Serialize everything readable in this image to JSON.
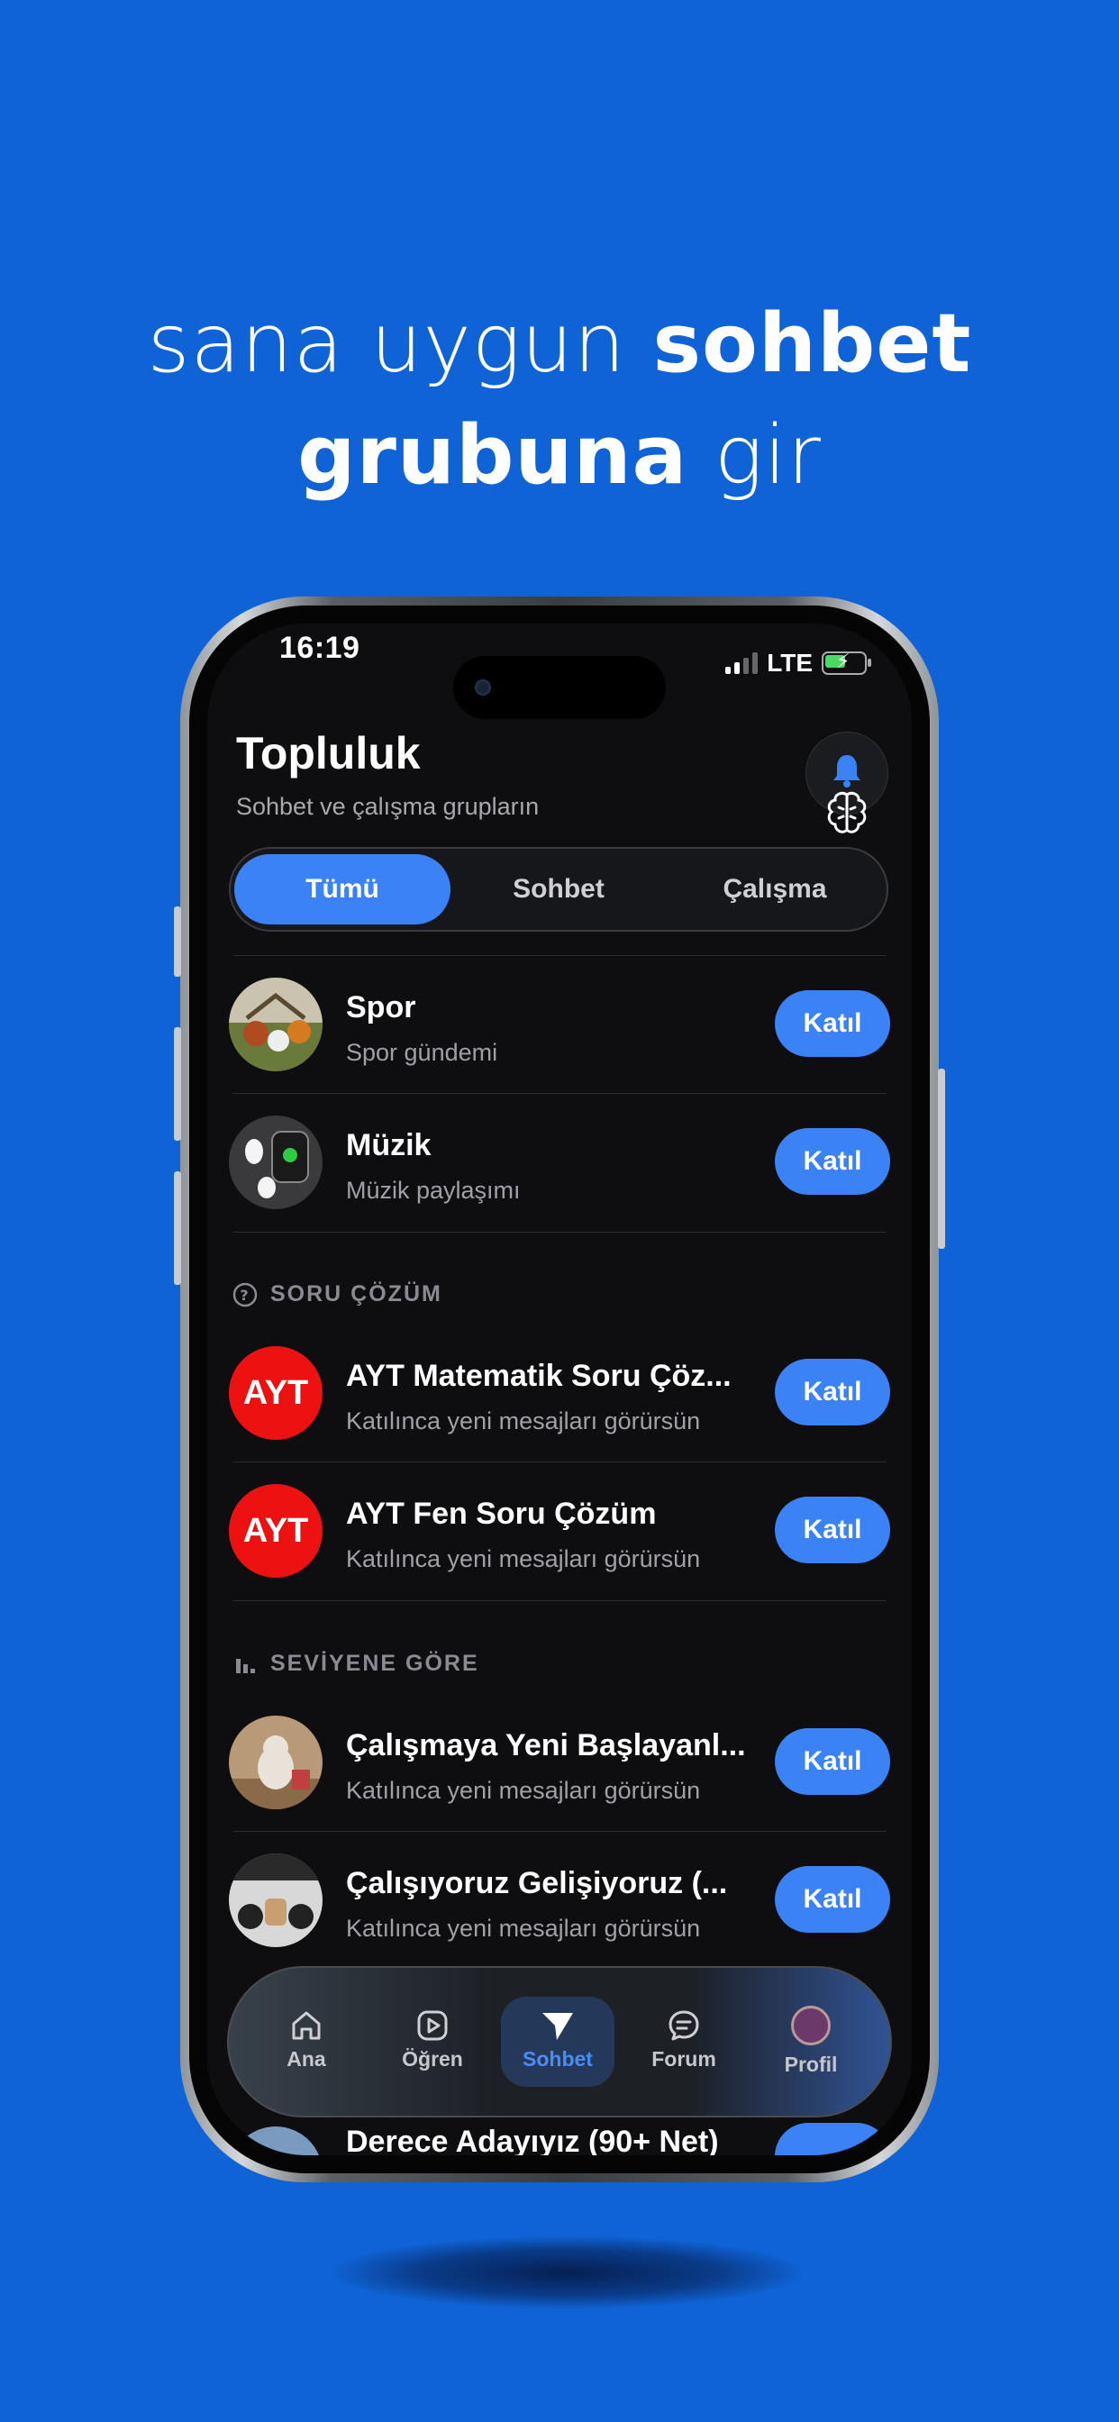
{
  "headline": {
    "line1_light": "sana uygun ",
    "line1_bold": "sohbet",
    "line2_bold": "grubuna",
    "line2_light": " gir"
  },
  "status": {
    "time": "16:19",
    "network": "LTE"
  },
  "header": {
    "title": "Topluluk",
    "subtitle": "Sohbet ve çalışma grupların"
  },
  "filter_tabs": [
    {
      "label": "Tümü",
      "active": true
    },
    {
      "label": "Sohbet",
      "active": false
    },
    {
      "label": "Çalışma",
      "active": false
    }
  ],
  "groups_top": [
    {
      "title": "Spor",
      "subtitle": "Spor gündemi",
      "join": "Katıl"
    },
    {
      "title": "Müzik",
      "subtitle": "Müzik paylaşımı",
      "join": "Katıl"
    }
  ],
  "section_soru": {
    "label": "SORU ÇÖZÜM"
  },
  "groups_soru": [
    {
      "avatar_text": "AYT",
      "title": "AYT Matematik Soru Çöz...",
      "subtitle": "Katılınca yeni mesajları görürsün",
      "join": "Katıl"
    },
    {
      "avatar_text": "AYT",
      "title": "AYT Fen Soru Çözüm",
      "subtitle": "Katılınca yeni mesajları görürsün",
      "join": "Katıl"
    }
  ],
  "section_seviye": {
    "label": "SEVİYENE GÖRE"
  },
  "groups_seviye": [
    {
      "title": "Çalışmaya Yeni Başlayanl...",
      "subtitle": "Katılınca yeni mesajları görürsün",
      "join": "Katıl"
    },
    {
      "title": "Çalışıyoruz Gelişiyoruz (...",
      "subtitle": "Katılınca yeni mesajları görürsün",
      "join": "Katıl"
    }
  ],
  "peek_row": {
    "title": "Derece Adayıyız (90+ Net)"
  },
  "tabbar": {
    "items": [
      {
        "label": "Ana",
        "icon": "home-icon"
      },
      {
        "label": "Öğren",
        "icon": "play-icon"
      },
      {
        "label": "Sohbet",
        "icon": "send-icon",
        "active": true
      },
      {
        "label": "Forum",
        "icon": "chat-icon"
      },
      {
        "label": "Profil",
        "icon": "avatar"
      }
    ]
  },
  "colors": {
    "background": "#0f63d6",
    "accent": "#3b82f6",
    "ayt_red": "#ee1111",
    "screen": "#0e0e10"
  }
}
